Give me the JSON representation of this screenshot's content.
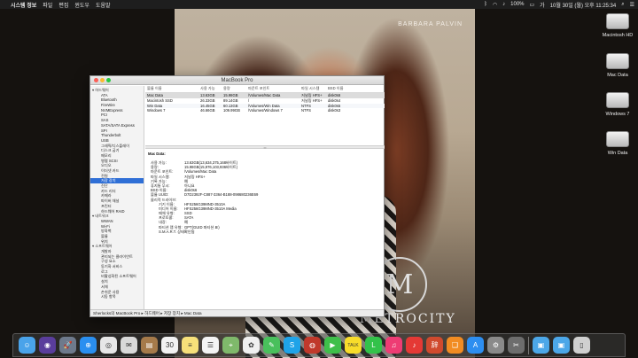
{
  "menubar": {
    "app_name": "시스템 정보",
    "menus": [
      "파일",
      "편집",
      "윈도우",
      "도움말"
    ],
    "battery": "100%",
    "clock": "10월 30일 (월) 오후 11:25:34"
  },
  "wallpaper": {
    "caption": "BARBARA PALVIN",
    "logo_letter": "M",
    "logo_text": "METROCITY"
  },
  "desktop_icons": [
    "Macintosh HD",
    "Mac Data",
    "Windows 7",
    "Win Data"
  ],
  "window": {
    "title": "MacBook Pro",
    "sidebar": [
      {
        "label": "▾ 하드웨어",
        "type": "group"
      },
      {
        "label": "ATA"
      },
      {
        "label": "Bluetooth"
      },
      {
        "label": "FireWire"
      },
      {
        "label": "NVMExpress"
      },
      {
        "label": "PCI"
      },
      {
        "label": "SAS"
      },
      {
        "label": "SATA/SATA Express"
      },
      {
        "label": "SPI"
      },
      {
        "label": "Thunderbolt"
      },
      {
        "label": "USB"
      },
      {
        "label": "그래픽/디스플레이"
      },
      {
        "label": "디스크 굽기"
      },
      {
        "label": "메모리"
      },
      {
        "label": "병렬 SCSI"
      },
      {
        "label": "오디오"
      },
      {
        "label": "이더넷 카드"
      },
      {
        "label": "전원"
      },
      {
        "label": "저장 장치",
        "selected": true
      },
      {
        "label": "진단"
      },
      {
        "label": "카드 리더"
      },
      {
        "label": "카메라"
      },
      {
        "label": "파이버 채널"
      },
      {
        "label": "프린터"
      },
      {
        "label": "하드웨어 RAID"
      },
      {
        "label": "▾ 네트워크",
        "type": "group"
      },
      {
        "label": "WWAN"
      },
      {
        "label": "Wi-Fi"
      },
      {
        "label": "방화벽"
      },
      {
        "label": "볼륨"
      },
      {
        "label": "위치"
      },
      {
        "label": "▾ 소프트웨어",
        "type": "group"
      },
      {
        "label": "개발자"
      },
      {
        "label": "관리되는 클라이언트"
      },
      {
        "label": "구성 요소"
      },
      {
        "label": "동기화 서비스"
      },
      {
        "label": "로그"
      },
      {
        "label": "비활성화된 소프트웨어"
      },
      {
        "label": "설치"
      },
      {
        "label": "서체"
      },
      {
        "label": "손쉬운 사용"
      },
      {
        "label": "시동 항목"
      }
    ],
    "table": {
      "headers": [
        "볼륨 이름",
        "사용 가능",
        "용량",
        "마운트 포인트",
        "파일 시스템",
        "BSD 이름"
      ],
      "rows": [
        [
          "Mac Data",
          "13.63GB",
          "15.98GB",
          "/Volumes/Mac Data",
          "저널링 HFS+",
          "disk0s6"
        ],
        [
          "Macintosh SSD",
          "26.33GB",
          "89.14GB",
          "/",
          "저널링 HFS+",
          "disk0s4"
        ],
        [
          "Win Data",
          "16.45GB",
          "60.13GB",
          "/Volumes/Win Data",
          "NTFS",
          "disk0s5"
        ],
        [
          "Windows 7",
          "46.66GB",
          "109.99GB",
          "/Volumes/Windows 7",
          "NTFS",
          "disk0s3"
        ]
      ]
    },
    "detail": {
      "title": "Mac Data:",
      "fields": [
        {
          "k": "사용 가능:",
          "v": "13.63GB(13,634,375,168바이트)"
        },
        {
          "k": "용량:",
          "v": "15.98GB(15,976,103,936바이트)"
        },
        {
          "k": "마운트 포인트:",
          "v": "/Volumes/Mac Data"
        },
        {
          "k": "파일 시스템:",
          "v": "저널링 HFS+"
        },
        {
          "k": "기록 가능:",
          "v": "예"
        },
        {
          "k": "휴지통 무시:",
          "v": "아니요"
        },
        {
          "k": "BSD 이름:",
          "v": "disk0s6"
        },
        {
          "k": "볼륨 UUID:",
          "v": "D7D2392F-C887-3364-B188-098680236E69"
        },
        {
          "k": "물리적 드라이브:",
          "v": ""
        },
        {
          "k": "기기 이름:",
          "v": "HFS256G39MND-3510A",
          "indent": true
        },
        {
          "k": "미디어 이름:",
          "v": "HFS256G39MND-3510A Media",
          "indent": true
        },
        {
          "k": "매체 유형:",
          "v": "SSD",
          "indent": true
        },
        {
          "k": "프로토콜:",
          "v": "SATA",
          "indent": true
        },
        {
          "k": "내장:",
          "v": "예",
          "indent": true
        },
        {
          "k": "파티션 맵 유형:",
          "v": "GPT(GUID 파티션 표)",
          "indent": true
        },
        {
          "k": "S.M.A.R.T. 상태:",
          "v": "확인됨",
          "indent": true
        }
      ]
    },
    "statusbar": "Sherlocks의 MacBook Pro ▸ 하드웨어 ▸ 저장 장치 ▸ Mac Data"
  },
  "dock": {
    "icons": [
      {
        "name": "finder-icon",
        "color": "#4aa3ea",
        "glyph": "☺"
      },
      {
        "name": "siri-icon",
        "color": "#5a3d9c",
        "glyph": "◉"
      },
      {
        "name": "launchpad-icon",
        "color": "#6e7a8c",
        "glyph": "🚀"
      },
      {
        "name": "safari-icon",
        "color": "#2a8ff0",
        "glyph": "⊕"
      },
      {
        "name": "chrome-icon",
        "color": "#e7e7e7",
        "glyph": "◎"
      },
      {
        "name": "mail-icon",
        "color": "#d9d9d9",
        "glyph": "✉"
      },
      {
        "name": "contacts-icon",
        "color": "#a57a4a",
        "glyph": "▤"
      },
      {
        "name": "calendar-icon",
        "color": "#f2f2f2",
        "glyph": "30"
      },
      {
        "name": "notes-icon",
        "color": "#f6e07a",
        "glyph": "≡"
      },
      {
        "name": "reminders-icon",
        "color": "#f4f4f4",
        "glyph": "☰"
      },
      {
        "name": "maps-icon",
        "color": "#7fb96b",
        "glyph": "⌖"
      },
      {
        "name": "photos-icon",
        "color": "#f0f0f0",
        "glyph": "✿"
      },
      {
        "name": "messages-icon",
        "color": "#49c05c",
        "glyph": "✎"
      },
      {
        "name": "skype-icon",
        "color": "#1fa3e8",
        "glyph": "S"
      },
      {
        "name": "photo-booth-icon",
        "color": "#c0392b",
        "glyph": "◍"
      },
      {
        "name": "facetime-icon",
        "color": "#3fbf4a",
        "glyph": "▶"
      },
      {
        "name": "kakaotalk-icon",
        "color": "#f8dc2a",
        "glyph": "TALK"
      },
      {
        "name": "line-icon",
        "color": "#33c24a",
        "glyph": "L"
      },
      {
        "name": "itunes-icon",
        "color": "#ee3c74",
        "glyph": "♫"
      },
      {
        "name": "music-icon",
        "color": "#e53935",
        "glyph": "♪"
      },
      {
        "name": "dictionary-icon",
        "color": "#d04a2e",
        "glyph": "辞"
      },
      {
        "name": "books-icon",
        "color": "#f28c22",
        "glyph": "❑"
      },
      {
        "name": "app-store-icon",
        "color": "#2d8ef0",
        "glyph": "A"
      },
      {
        "name": "system-preferences-icon",
        "color": "#8a8a8a",
        "glyph": "⚙"
      },
      {
        "name": "script-editor-icon",
        "color": "#6d6d6d",
        "glyph": "✂"
      }
    ],
    "folders": [
      {
        "name": "downloads-folder-icon",
        "color": "#4ca7e8",
        "glyph": "▣"
      },
      {
        "name": "documents-folder-icon",
        "color": "#4ca7e8",
        "glyph": "▣"
      },
      {
        "name": "trash-icon",
        "color": "#d0d0d0",
        "glyph": "▯"
      }
    ]
  }
}
